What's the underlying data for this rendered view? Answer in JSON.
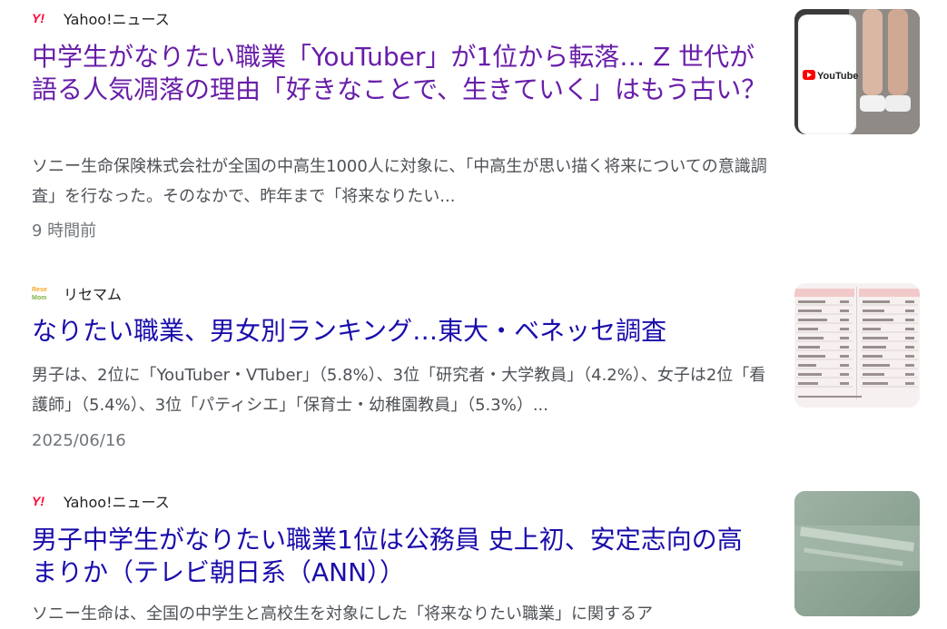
{
  "results": [
    {
      "source": "Yahoo!ニュース",
      "favicon": "yahoo-logo-icon",
      "title": "中学生がなりたい職業「YouTuber」が1位から転落… Z 世代が語る人気凋落の理由「好きなことで、生きていく」はもう古い？",
      "snippet": "ソニー生命保険株式会社が全国の中高生1000人に対象に、「中高生が思い描く将来についての意識調査」を行なった。そのなかで、昨年まで「将来なりたい...",
      "time": "9 時間前",
      "thumbnail": "phone-youtube-thumbnail"
    },
    {
      "source": "リセマム",
      "favicon": "resemom-logo-icon",
      "title": "なりたい職業、男女別ランキング…東大・ベネッセ調査",
      "snippet": "男子は、2位に「YouTuber・VTuber」（5.8%）、3位「研究者・大学教員」（4.2%）、女子は2位「看護師」（5.4%）、3位「パティシエ」「保育士・幼稚園教員」（5.3%）...",
      "time": "2025/06/16",
      "thumbnail": "ranking-table-thumbnail"
    },
    {
      "source": "Yahoo!ニュース",
      "favicon": "yahoo-logo-icon",
      "title": "男子中学生がなりたい職業1位は公務員 史上初、安定志向の高まりか（テレビ朝日系（ANN））",
      "snippet": "ソニー生命は、全国の中学生と高校生を対象にした「将来なりたい職業」に関するア",
      "thumbnail": "sony-sign-thumbnail"
    }
  ]
}
